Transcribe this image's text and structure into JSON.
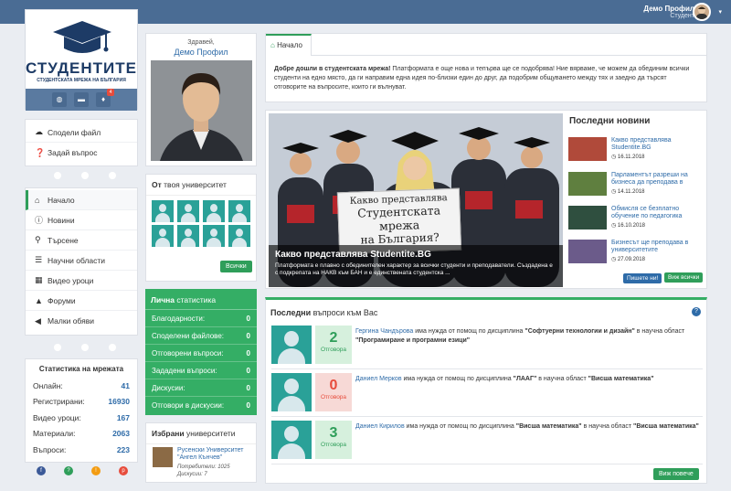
{
  "topbar": {
    "user_name": "Демо Профил",
    "user_role": "Студент",
    "caret": "▾"
  },
  "logo": {
    "brand": "СТУДЕНТИТЕ",
    "subtitle": "СТУДЕНТСКАТА МРЕЖА НА БЪЛГАРИЯ",
    "notification_count": "4"
  },
  "actions": [
    {
      "label": "Сподели файл",
      "icon": "share-icon"
    },
    {
      "label": "Задай въпрос",
      "icon": "question-icon"
    }
  ],
  "nav": [
    {
      "label": "Начало",
      "icon": "home-icon",
      "active": true
    },
    {
      "label": "Новини",
      "icon": "info-icon"
    },
    {
      "label": "Търсене",
      "icon": "search-icon"
    },
    {
      "label": "Научни области",
      "icon": "list-icon"
    },
    {
      "label": "Видео уроци",
      "icon": "video-icon"
    },
    {
      "label": "Форуми",
      "icon": "graduation-icon"
    },
    {
      "label": "Малки обяви",
      "icon": "megaphone-icon"
    }
  ],
  "net_stats": {
    "title": "Статистика на мрежата",
    "rows": [
      {
        "label": "Онлайн:",
        "value": "41"
      },
      {
        "label": "Регистрирани:",
        "value": "16930"
      },
      {
        "label": "Видео уроци:",
        "value": "167"
      },
      {
        "label": "Материали:",
        "value": "2063"
      },
      {
        "label": "Въпроси:",
        "value": "223"
      }
    ]
  },
  "social_colors": [
    "#3b5998",
    "#2f9e5a",
    "#f39c12",
    "#e74c3c"
  ],
  "profile": {
    "greeting": "Здравей,",
    "name": "Демо Профил"
  },
  "university": {
    "title_bold": "От",
    "title_rest": " твоя университет",
    "button": "Всички"
  },
  "personal_stats": {
    "title_bold": "Лична",
    "title_rest": " статистика",
    "rows": [
      {
        "label": "Благодарности:",
        "value": "0"
      },
      {
        "label": "Споделени файлове:",
        "value": "0"
      },
      {
        "label": "Отговорени въпроси:",
        "value": "0"
      },
      {
        "label": "Зададени въпроси:",
        "value": "0"
      },
      {
        "label": "Дискусии:",
        "value": "0"
      },
      {
        "label": "Отговори в дискусии:",
        "value": "0"
      }
    ]
  },
  "chosen": {
    "title_bold": "Избрани",
    "title_rest": " университети",
    "uni_name": "Русенски Университет \"Ангел Кънчев\"",
    "users": "Потребители: 1025",
    "discussions": "Дискусии: 7"
  },
  "welcome": {
    "tab": "Начало",
    "lead": "Добре дошли в студентската мрежа!",
    "text": " Платформата е още нова и тепърва ще се подобрява! Ние вярваме, че можем да обединим всички студенти на едно място, да ги направим една идея по-близки един до друг, да подобрим общуването между тях и заедно да търсят отговорите на въпросите, които ги вълнуват."
  },
  "hero": {
    "sign_l1": "Какво представлява",
    "sign_l2": "Студентската мрежа",
    "sign_l3": "на България?",
    "title": "Какво представлява Studentite.BG",
    "desc": "Платформата е плавно с обединителен характер за всички студенти и преподаватели. Създадена е с подкрепата на НАКВ към БАН и е единствената студентска ..."
  },
  "latest_news": {
    "title": "Последни новини",
    "items": [
      {
        "title": "Какво представлява Studentite.BG",
        "date": "16.11.2018",
        "thumb": "#b04a3a"
      },
      {
        "title": "Парламентът разреши на бизнеса да преподава в",
        "date": "14.11.2018",
        "thumb": "#5f7f3f"
      },
      {
        "title": "Обмисля се безплатно обучение по педагогика",
        "date": "16.10.2018",
        "thumb": "#2f4f3f"
      },
      {
        "title": "Бизнесът ще преподава в университетите",
        "date": "27.09.2018",
        "thumb": "#6b5b8a"
      }
    ],
    "btn_write": "Пишете ни!",
    "btn_all": "Виж всички"
  },
  "questions": {
    "title_bold": "Последни",
    "title_rest": " въпроси към Вас",
    "items": [
      {
        "user": "Гергина Чандърова",
        "count": "2",
        "answers_label": "Отговора",
        "count_color": "#2f9e5a",
        "bg": "#d6f0dd",
        "pre": " има нужда от помощ по дисциплина ",
        "discipline": "\"Софтуерни технологии и дизайн\"",
        "mid": " в научна област ",
        "field": "\"Програмиране и програмни езици\""
      },
      {
        "user": "Даниел Мерков",
        "count": "0",
        "answers_label": "Отговора",
        "count_color": "#e74c3c",
        "bg": "#f7d9d6",
        "pre": " има нужда от помощ по дисциплина ",
        "discipline": "\"ЛААГ\"",
        "mid": " в научна област ",
        "field": "\"Висша математика\""
      },
      {
        "user": "Даниел Кирилов",
        "count": "3",
        "answers_label": "Отговора",
        "count_color": "#2f9e5a",
        "bg": "#d6f0dd",
        "pre": " има нужда от помощ по дисциплина ",
        "discipline": "\"Висша математика\"",
        "mid": " в научна област ",
        "field": "\"Висша математика\""
      }
    ],
    "more_button": "Виж повече"
  }
}
